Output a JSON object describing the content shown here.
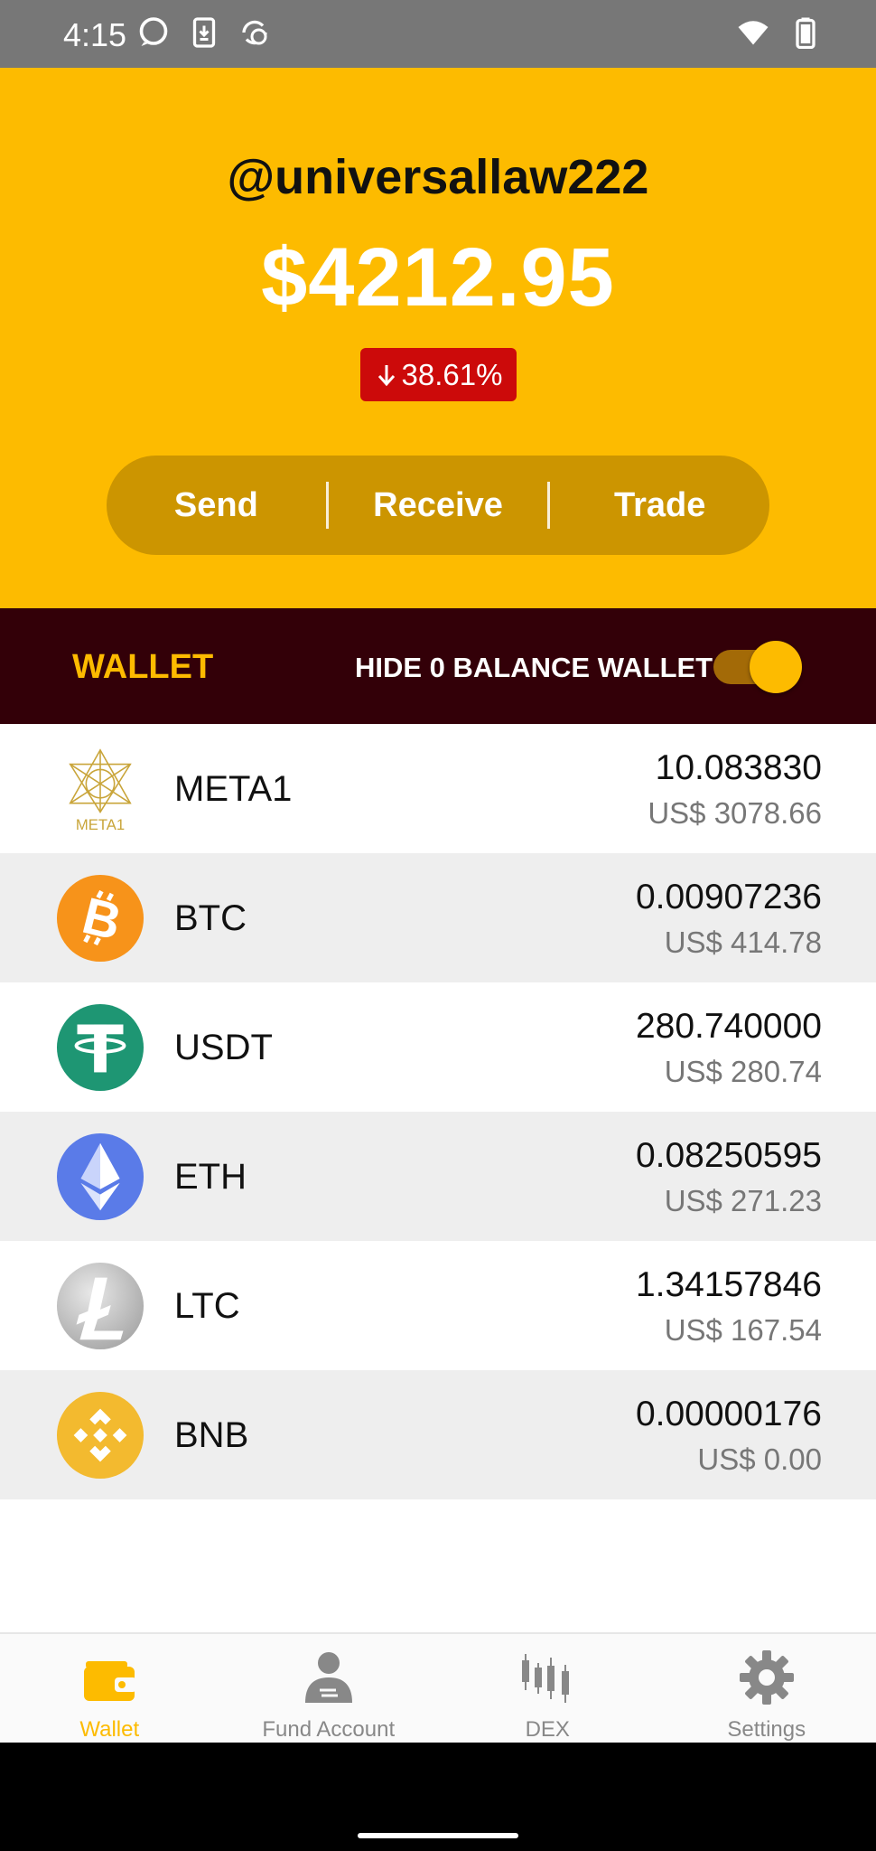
{
  "status_bar": {
    "time": "4:15",
    "icons_left": [
      "chat-bubble-icon",
      "download-icon",
      "sync-icon"
    ],
    "icons_right": [
      "wifi-icon",
      "battery-icon"
    ]
  },
  "header": {
    "username": "@universallaw222",
    "balance": "$4212.95",
    "change": "38.61%",
    "change_direction": "down",
    "badge_color": "#CC0A0A",
    "actions": {
      "send": "Send",
      "receive": "Receive",
      "trade": "Trade"
    }
  },
  "wallet_bar": {
    "title": "WALLET",
    "hide_zero_label": "HIDE 0 BALANCE WALLET",
    "hide_zero_enabled": true
  },
  "assets": [
    {
      "symbol": "META1",
      "amount": "10.083830",
      "usd": "US$ 3078.66",
      "icon": "meta1-logo-icon",
      "logo_text": "META1"
    },
    {
      "symbol": "BTC",
      "amount": "0.00907236",
      "usd": "US$ 414.78",
      "icon": "bitcoin-icon"
    },
    {
      "symbol": "USDT",
      "amount": "280.740000",
      "usd": "US$ 280.74",
      "icon": "tether-icon"
    },
    {
      "symbol": "ETH",
      "amount": "0.08250595",
      "usd": "US$ 271.23",
      "icon": "ethereum-icon"
    },
    {
      "symbol": "LTC",
      "amount": "1.34157846",
      "usd": "US$ 167.54",
      "icon": "litecoin-icon"
    },
    {
      "symbol": "BNB",
      "amount": "0.00000176",
      "usd": "US$ 0.00",
      "icon": "binance-icon"
    }
  ],
  "bottom_nav": {
    "items": [
      {
        "label": "Wallet",
        "icon": "wallet-icon",
        "active": true
      },
      {
        "label": "Fund Account",
        "icon": "fund-account-icon",
        "active": false
      },
      {
        "label": "DEX",
        "icon": "candlestick-icon",
        "active": false
      },
      {
        "label": "Settings",
        "icon": "gear-icon",
        "active": false
      }
    ]
  },
  "colors": {
    "accent": "#FDBB00",
    "pill": "#CC9500",
    "wallet_bar": "#330008",
    "negative": "#CC0A0A",
    "inactive": "#888888"
  }
}
